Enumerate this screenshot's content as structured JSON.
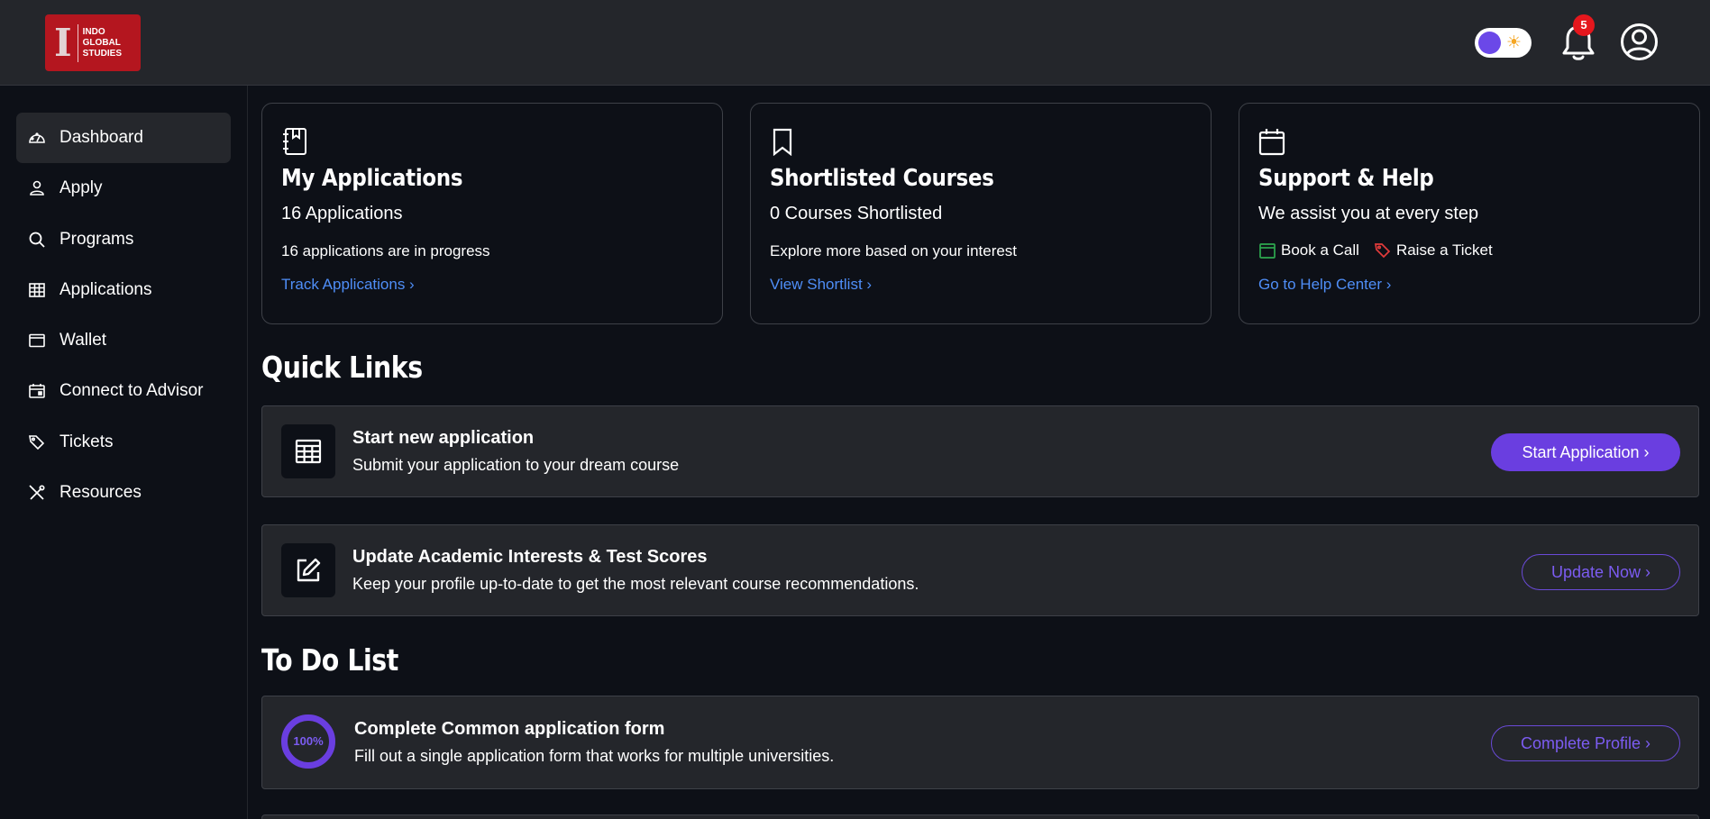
{
  "header": {
    "logo_text": [
      "INDO",
      "GLOBAL",
      "STUDIES"
    ],
    "logo_mark": "I",
    "notifications_count": "5",
    "theme": "dark",
    "colors": {
      "accent": "#6a3ee0",
      "link": "#4f8ef7",
      "badge": "#e5171d",
      "logo_bg": "#b4161f"
    }
  },
  "sidebar": {
    "items": [
      {
        "label": "Dashboard",
        "icon": "dashboard-gauge-icon",
        "active": true
      },
      {
        "label": "Apply",
        "icon": "user-icon"
      },
      {
        "label": "Programs",
        "icon": "search-icon"
      },
      {
        "label": "Applications",
        "icon": "table-icon"
      },
      {
        "label": "Wallet",
        "icon": "wallet-icon"
      },
      {
        "label": "Connect to Advisor",
        "icon": "calendar-icon"
      },
      {
        "label": "Tickets",
        "icon": "tag-icon"
      },
      {
        "label": "Resources",
        "icon": "tools-icon"
      }
    ]
  },
  "cards": {
    "applications": {
      "icon": "notebook-icon",
      "title": "My Applications",
      "subtitle": "16 Applications",
      "description": "16 applications are in progress",
      "link": "Track Applications ›"
    },
    "shortlist": {
      "icon": "bookmark-icon",
      "title": "Shortlisted Courses",
      "subtitle": "0 Courses Shortlisted",
      "description": "Explore more based on your interest",
      "link": "View Shortlist ›"
    },
    "support": {
      "icon": "calendar-icon",
      "title": "Support & Help",
      "subtitle": "We assist you at every step",
      "book_call": "Book a Call",
      "raise_ticket": "Raise a Ticket",
      "link": "Go to Help Center ›"
    }
  },
  "quick_links": {
    "title": "Quick Links",
    "items": [
      {
        "icon": "table-icon",
        "title": "Start new application",
        "description": "Submit your application to your dream course",
        "button": "Start Application ›"
      },
      {
        "icon": "edit-icon",
        "title": "Update Academic Interests & Test Scores",
        "description": "Keep your profile up-to-date to get the most relevant course recommendations.",
        "button": "Update Now ›"
      }
    ]
  },
  "todo": {
    "title": "To Do List",
    "items": [
      {
        "progress_label": "100%",
        "progress": 1.0,
        "title": "Complete Common application form",
        "description": "Fill out a single application form that works for multiple universities.",
        "button": "Complete Profile ›"
      }
    ]
  }
}
